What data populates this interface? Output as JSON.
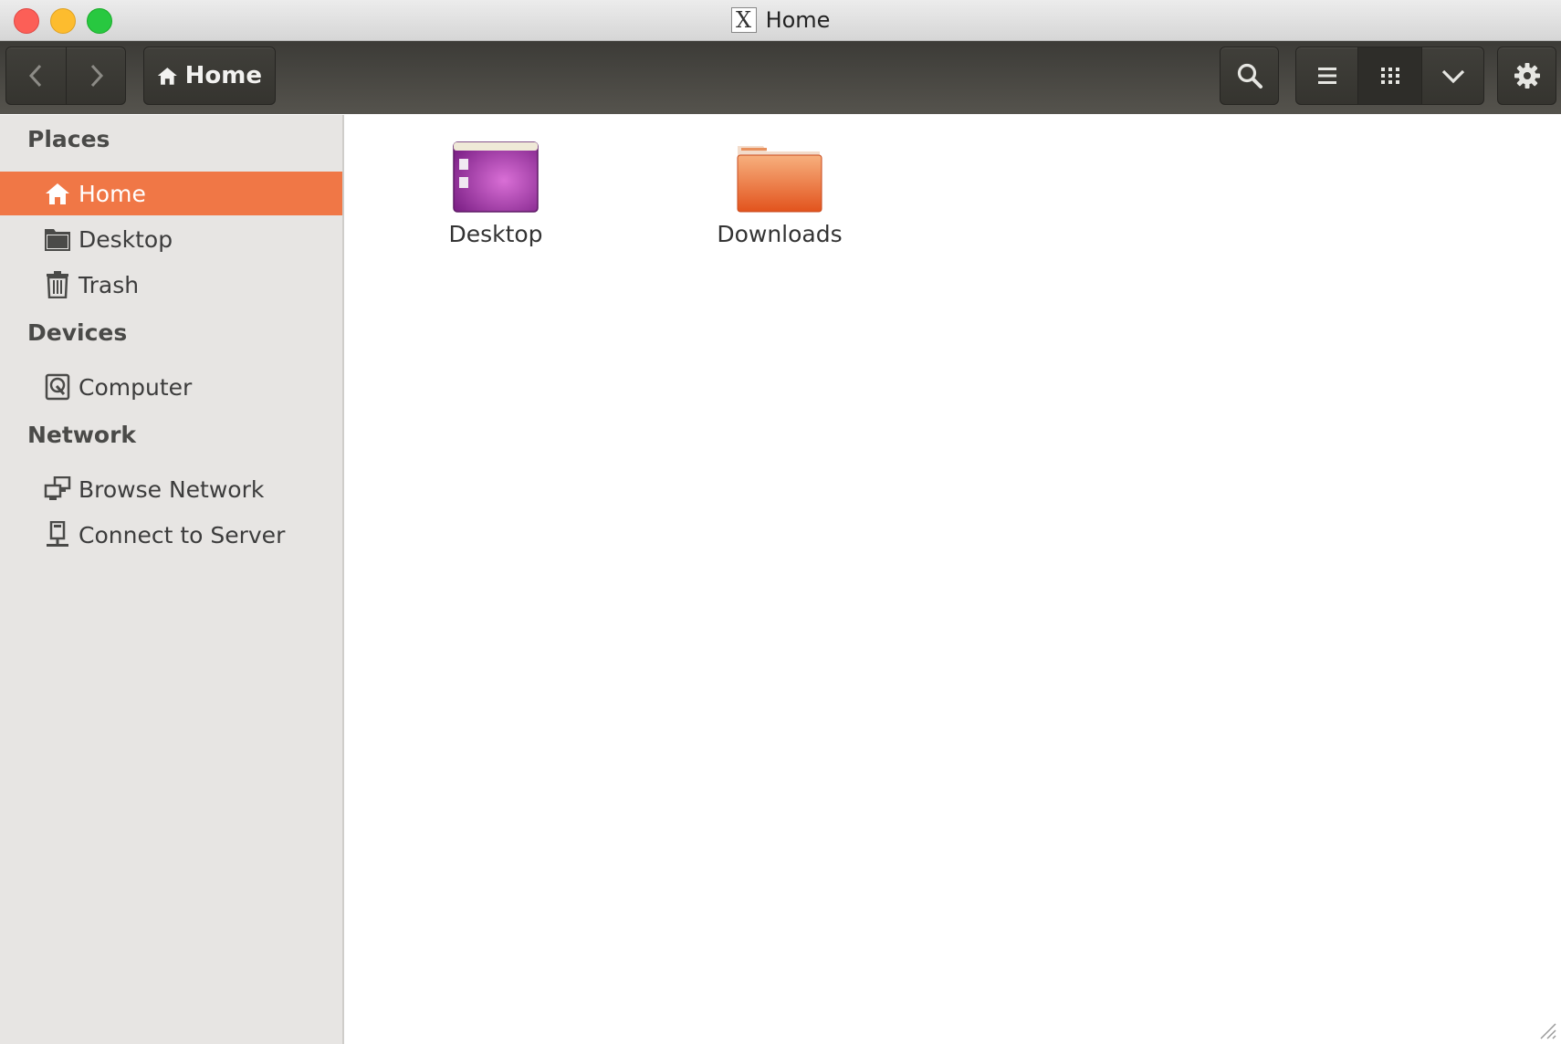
{
  "window": {
    "title": "Home",
    "app_icon": "x11-icon",
    "app_icon_glyph": "X"
  },
  "toolbar": {
    "back_icon": "chevron-left-icon",
    "forward_icon": "chevron-right-icon",
    "path_label": "Home",
    "search_icon": "search-icon",
    "list_view_icon": "list-view-icon",
    "grid_view_icon": "grid-view-icon",
    "view_options_icon": "chevron-down-icon",
    "settings_icon": "gear-icon",
    "active_view": "grid"
  },
  "sidebar": {
    "sections": [
      {
        "heading": "Places",
        "items": [
          {
            "label": "Home",
            "icon": "home-icon",
            "selected": true
          },
          {
            "label": "Desktop",
            "icon": "folder-icon",
            "selected": false
          },
          {
            "label": "Trash",
            "icon": "trash-icon",
            "selected": false
          }
        ]
      },
      {
        "heading": "Devices",
        "items": [
          {
            "label": "Computer",
            "icon": "harddisk-icon",
            "selected": false
          }
        ]
      },
      {
        "heading": "Network",
        "items": [
          {
            "label": "Browse Network",
            "icon": "network-icon",
            "selected": false
          },
          {
            "label": "Connect to Server",
            "icon": "server-icon",
            "selected": false
          }
        ]
      }
    ]
  },
  "files": [
    {
      "name": "Desktop",
      "icon": "desktop-folder-icon"
    },
    {
      "name": "Downloads",
      "icon": "folder-icon"
    }
  ],
  "colors": {
    "accent": "#f07746",
    "toolbar": "#3c3b37",
    "sidebar_bg": "#e7e5e3",
    "desktop_folder": "#8e2a9a",
    "downloads_folder": "#e8632c"
  }
}
